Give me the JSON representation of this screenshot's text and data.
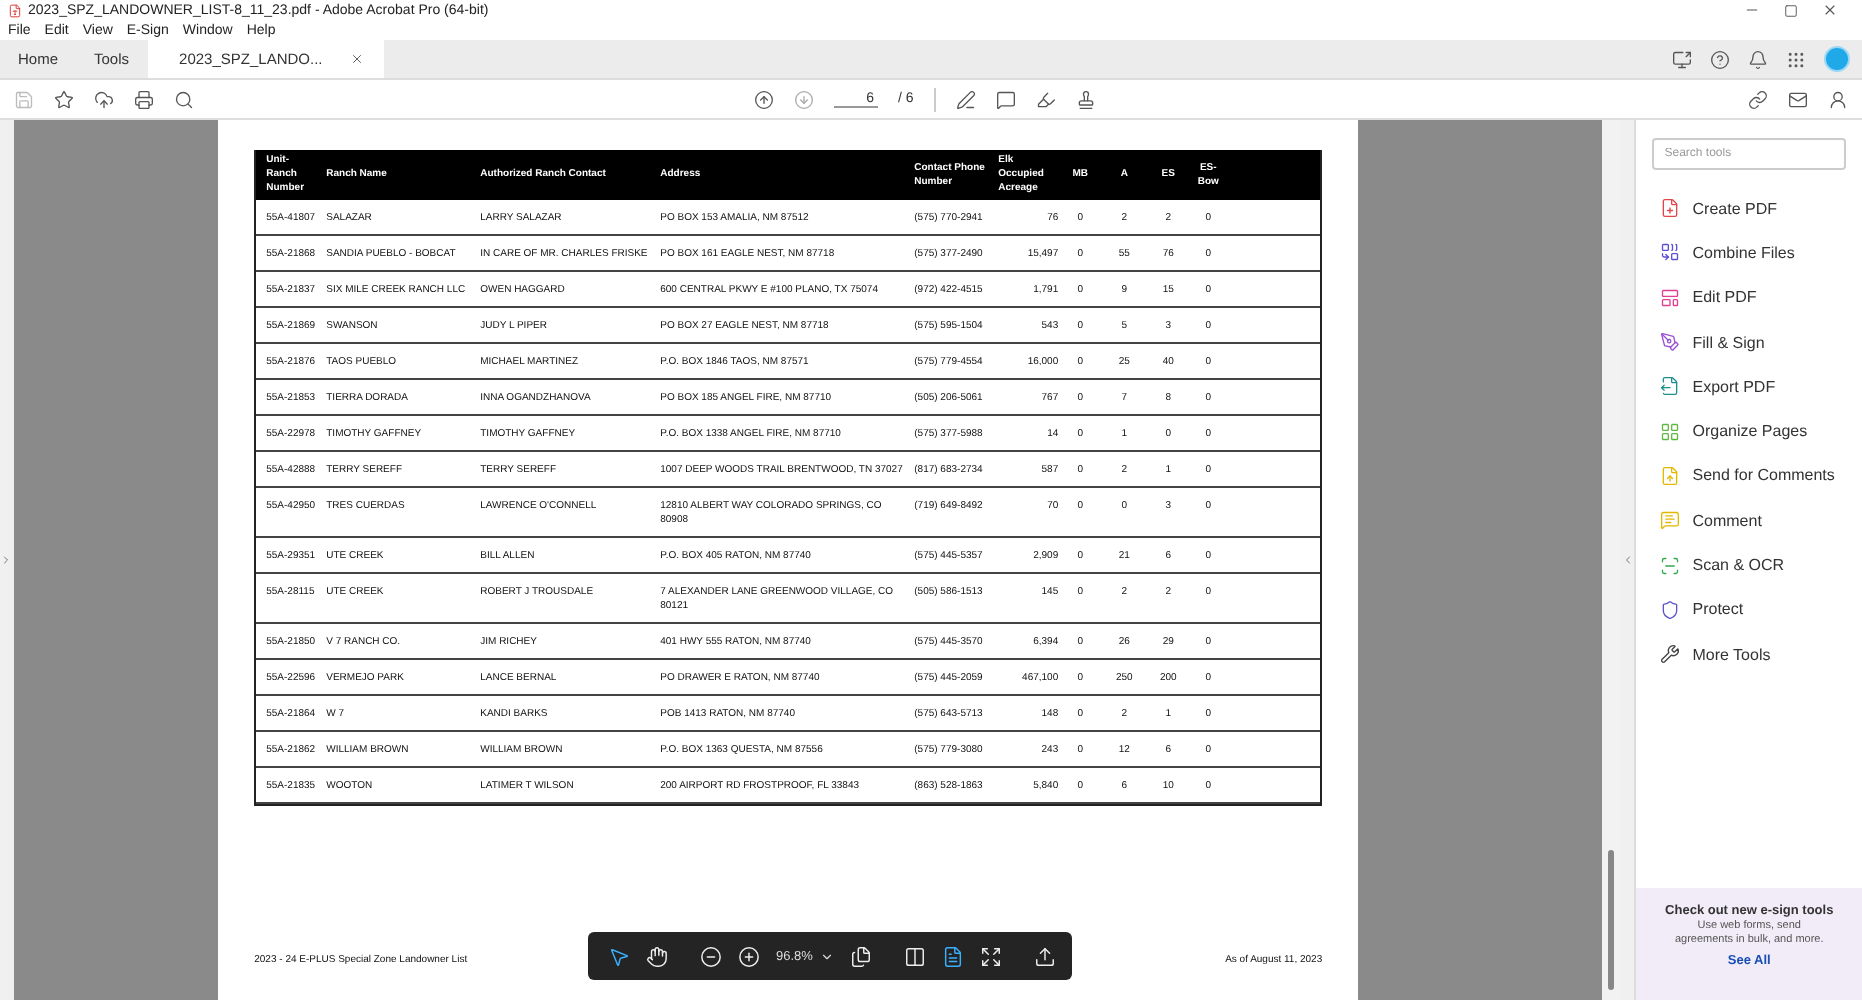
{
  "window": {
    "title": "2023_SPZ_LANDOWNER_LIST-8_11_23.pdf - Adobe Acrobat Pro (64-bit)"
  },
  "menu": [
    "File",
    "Edit",
    "View",
    "E-Sign",
    "Window",
    "Help"
  ],
  "tabs": [
    {
      "label": "Home",
      "selected": false
    },
    {
      "label": "Tools",
      "selected": false
    },
    {
      "label": "2023_SPZ_LANDO...",
      "selected": true
    }
  ],
  "page_nav": {
    "current": "6",
    "total": "/ 6"
  },
  "table": {
    "columns": [
      "Unit-Ranch Number",
      "Ranch Name",
      "Authorized Ranch Contact",
      "Address",
      "Contact Phone Number",
      "Elk Occupied Acreage",
      "MB",
      "A",
      "ES",
      "ES-Bow"
    ],
    "rows": [
      [
        "55A-41807",
        "SALAZAR",
        "LARRY  SALAZAR",
        "PO BOX 153 AMALIA, NM 87512",
        "(575) 770-2941",
        "76",
        "0",
        "2",
        "2",
        "0"
      ],
      [
        "55A-21868",
        "SANDIA PUEBLO - BOBCAT",
        "IN CARE OF MR. CHARLES FRISKE",
        "PO BOX 161 EAGLE NEST, NM 87718",
        "(575) 377-2490",
        "15,497",
        "0",
        "55",
        "76",
        "0"
      ],
      [
        "55A-21837",
        "SIX MILE CREEK RANCH LLC",
        "OWEN HAGGARD",
        "600 CENTRAL PKWY E #100 PLANO, TX 75074",
        "(972) 422-4515",
        "1,791",
        "0",
        "9",
        "15",
        "0"
      ],
      [
        "55A-21869",
        "SWANSON",
        "JUDY L PIPER",
        "PO BOX 27 EAGLE NEST, NM 87718",
        "(575) 595-1504",
        "543",
        "0",
        "5",
        "3",
        "0"
      ],
      [
        "55A-21876",
        "TAOS PUEBLO",
        "MICHAEL MARTINEZ",
        "P.O. BOX 1846 TAOS, NM 87571",
        "(575) 779-4554",
        "16,000",
        "0",
        "25",
        "40",
        "0"
      ],
      [
        "55A-21853",
        "TIERRA DORADA",
        "INNA OGANDZHANOVA",
        "PO BOX 185 ANGEL FIRE, NM 87710",
        "(505) 206-5061",
        "767",
        "0",
        "7",
        "8",
        "0"
      ],
      [
        "55A-22978",
        "TIMOTHY GAFFNEY",
        "TIMOTHY GAFFNEY",
        "P.O. BOX 1338 ANGEL FIRE, NM 87710",
        "(575) 377-5988",
        "14",
        "0",
        "1",
        "0",
        "0"
      ],
      [
        "55A-42888",
        "TERRY SEREFF",
        "TERRY  SEREFF",
        "1007 DEEP WOODS TRAIL BRENTWOOD, TN 37027",
        "(817) 683-2734",
        "587",
        "0",
        "2",
        "1",
        "0"
      ],
      [
        "55A-42950",
        "TRES CUERDAS",
        "LAWRENCE O'CONNELL",
        "12810 ALBERT WAY COLORADO SPRINGS, CO 80908",
        "(719) 649-8492",
        "70",
        "0",
        "0",
        "3",
        "0"
      ],
      [
        "55A-29351",
        "UTE CREEK",
        "BILL ALLEN",
        "P.O. BOX 405 RATON, NM 87740",
        "(575) 445-5357",
        "2,909",
        "0",
        "21",
        "6",
        "0"
      ],
      [
        "55A-28115",
        "UTE CREEK",
        "ROBERT J TROUSDALE",
        "7 ALEXANDER LANE GREENWOOD VILLAGE, CO 80121",
        "(505) 586-1513",
        "145",
        "0",
        "2",
        "2",
        "0"
      ],
      [
        "55A-21850",
        "V 7 RANCH CO.",
        "JIM  RICHEY",
        "401 HWY 555 RATON, NM 87740",
        "(575) 445-3570",
        "6,394",
        "0",
        "26",
        "29",
        "0"
      ],
      [
        "55A-22596",
        "VERMEJO PARK",
        "LANCE BERNAL",
        "PO DRAWER E RATON, NM 87740",
        "(575) 445-2059",
        "467,100",
        "0",
        "250",
        "200",
        "0"
      ],
      [
        "55A-21864",
        "W 7",
        "KANDI BARKS",
        "POB 1413 RATON, NM 87740",
        "(575) 643-5713",
        "148",
        "0",
        "2",
        "1",
        "0"
      ],
      [
        "55A-21862",
        "WILLIAM BROWN",
        "WILLIAM BROWN",
        "P.O. BOX 1363 QUESTA, NM 87556",
        "(575) 779-3080",
        "243",
        "0",
        "12",
        "6",
        "0"
      ],
      [
        "55A-21835",
        "WOOTON",
        "LATIMER T WILSON",
        "200 AIRPORT RD FROSTPROOF, FL 33843",
        "(863) 528-1863",
        "5,840",
        "0",
        "6",
        "10",
        "0"
      ]
    ]
  },
  "footer": {
    "left": "2023 - 24 E-PLUS Special Zone Landowner List",
    "right": "As of August 11, 2023"
  },
  "float_toolbar": {
    "zoom": "96.8%",
    "tools": [
      {
        "kind": "select",
        "selected": true
      },
      {
        "kind": "hand",
        "selected": false
      }
    ],
    "views": [
      {
        "kind": "scroll",
        "selected": false
      },
      {
        "kind": "single",
        "selected": true
      },
      {
        "kind": "fit",
        "selected": false
      }
    ]
  },
  "tools_panel": {
    "search": {
      "placeholder": "Search tools"
    },
    "items": [
      "Create PDF",
      "Combine Files",
      "Edit PDF",
      "Fill & Sign",
      "Export PDF",
      "Organize Pages",
      "Send for Comments",
      "Comment",
      "Scan & OCR",
      "Protect",
      "More Tools"
    ],
    "promo": {
      "title": "Check out new e-sign tools",
      "text": "Use web forms, send agreements in bulk, and more.",
      "link": "See All"
    }
  }
}
